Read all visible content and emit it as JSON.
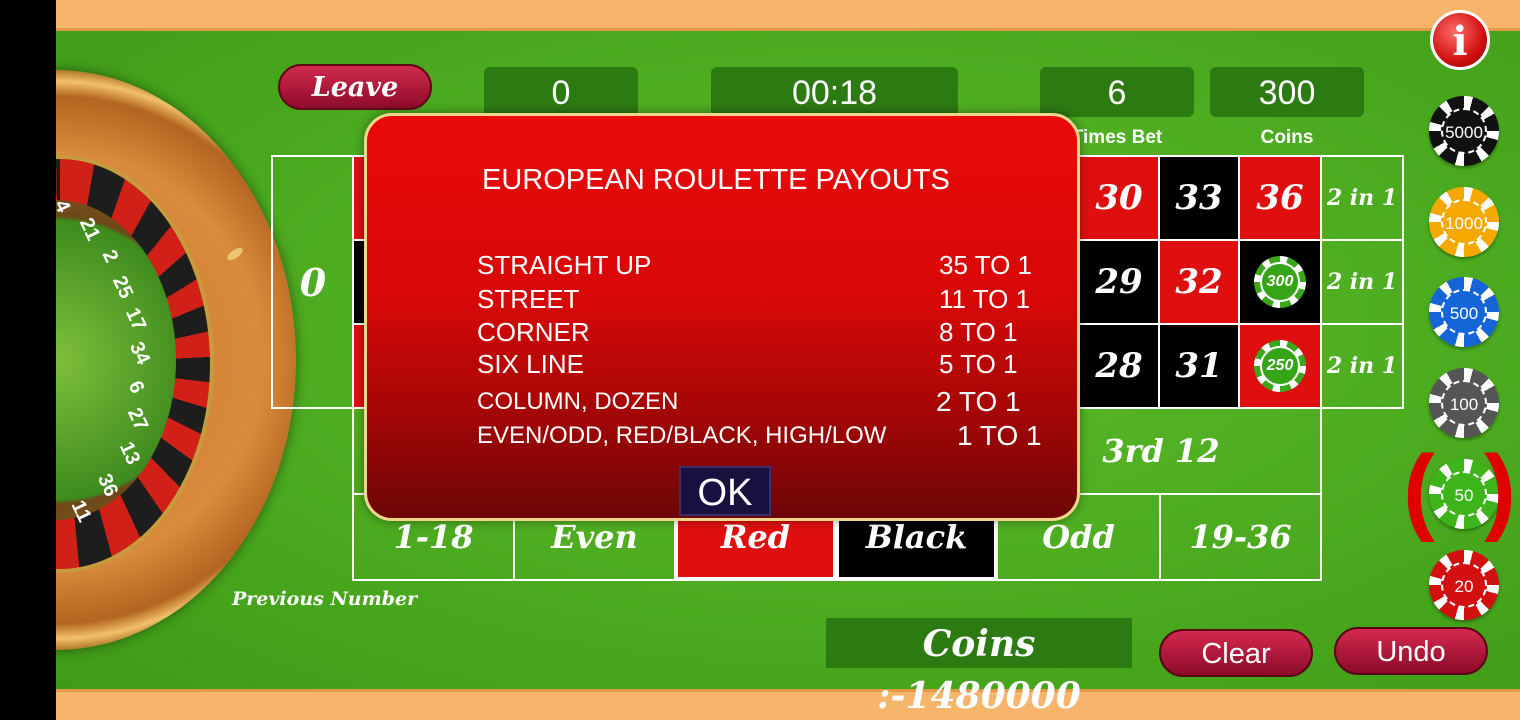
{
  "top_bar": {
    "leave_label": "Leave",
    "last_win_value": "0",
    "timer": "00:18",
    "times_bet_value": "6",
    "times_bet_label": "Times Bet",
    "coins_value": "300",
    "coins_label": "Coins"
  },
  "wheel": {
    "visible_numbers": [
      "4",
      "21",
      "2",
      "25",
      "17",
      "34",
      "6",
      "27",
      "13",
      "36",
      "11"
    ],
    "previous_number_label": "Previous Number"
  },
  "board": {
    "zero": "0",
    "visible_numbers": [
      {
        "value": "30",
        "color": "red"
      },
      {
        "value": "33",
        "color": "black"
      },
      {
        "value": "36",
        "color": "red"
      },
      {
        "value": "29",
        "color": "black"
      },
      {
        "value": "32",
        "color": "red"
      },
      {
        "value": "28",
        "color": "black"
      },
      {
        "value": "31",
        "color": "black"
      }
    ],
    "column_bets": [
      "2 in 1",
      "2 in 1",
      "2 in 1"
    ],
    "dozen_visible": "3rd 12",
    "outside_bets": [
      "1-18",
      "Even",
      "Red",
      "Black",
      "Odd",
      "19-36"
    ],
    "placed_chips": [
      {
        "cell": "35",
        "amount": "300"
      },
      {
        "cell": "34",
        "amount": "250"
      }
    ]
  },
  "chip_rack": {
    "denominations": [
      "5000",
      "1000",
      "500",
      "100",
      "50",
      "20"
    ],
    "selected": "50",
    "colors": {
      "5000": "#111111",
      "1000": "#f5a800",
      "500": "#1565d8",
      "100": "#555555",
      "50": "#3db51a",
      "20": "#d21010"
    }
  },
  "footer": {
    "coins_text": "Coins :-1480000",
    "clear_label": "Clear",
    "undo_label": "Undo"
  },
  "modal": {
    "title": "EUROPEAN ROULETTE PAYOUTS",
    "rows": [
      {
        "bet": "STRAIGHT UP",
        "payout": "35 TO 1"
      },
      {
        "bet": "STREET",
        "payout": "11 TO 1"
      },
      {
        "bet": "CORNER",
        "payout": "8 TO 1"
      },
      {
        "bet": "SIX LINE",
        "payout": "5 TO 1"
      },
      {
        "bet": "COLUMN, DOZEN",
        "payout": "2 TO 1"
      },
      {
        "bet": "EVEN/ODD, RED/BLACK, HIGH/LOW",
        "payout": "1 TO 1"
      }
    ],
    "ok_label": "OK"
  },
  "info_icon_glyph": "i",
  "colors": {
    "felt": "#4fae20",
    "red": "#e00f0f",
    "black": "#000000",
    "accent_button": "#b01a3c"
  }
}
